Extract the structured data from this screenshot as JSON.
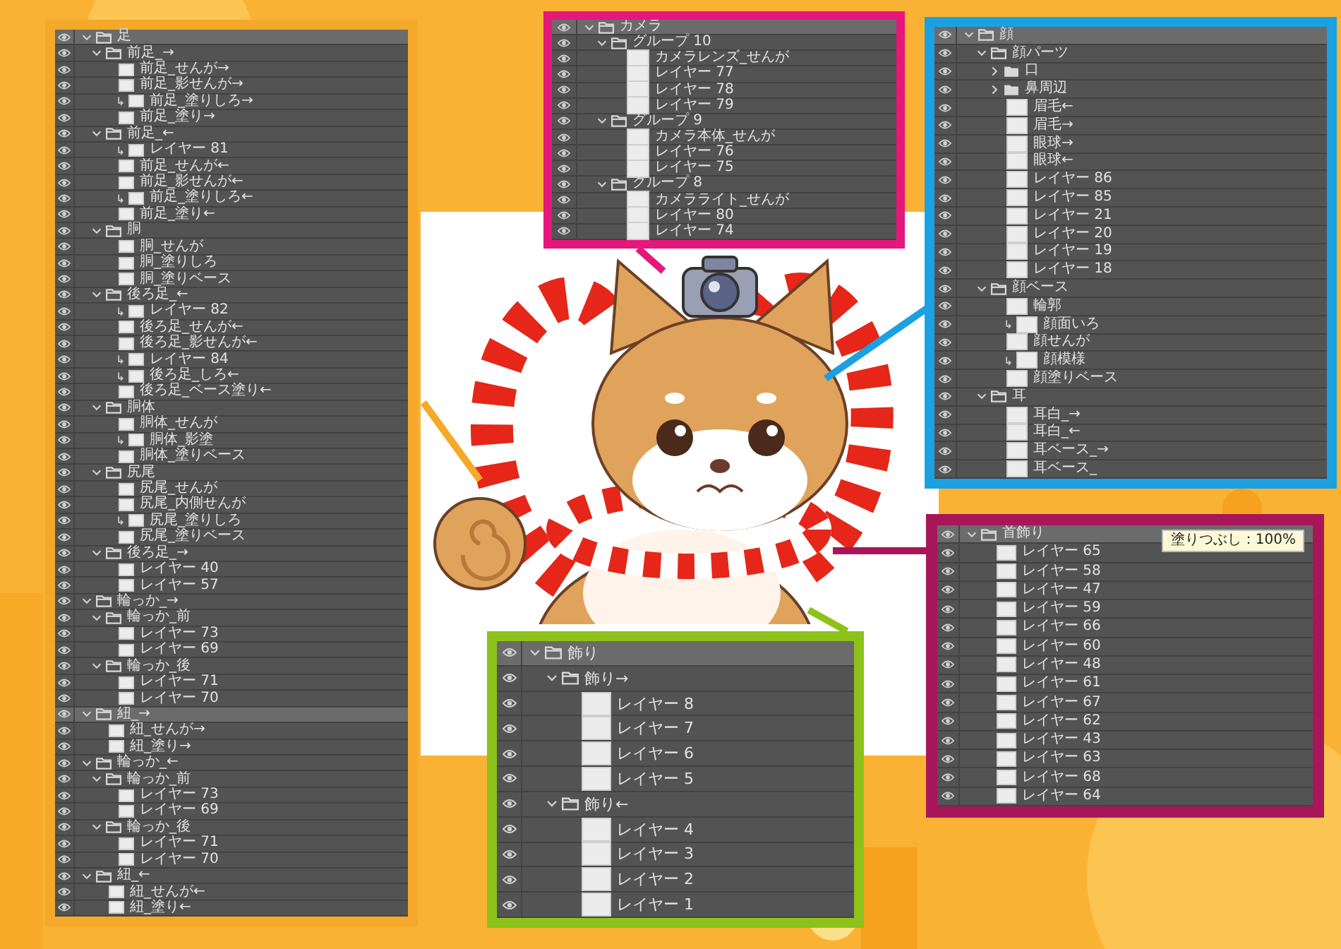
{
  "panels": [
    {
      "color": "#f4a92a",
      "rows": [
        {
          "label": "足",
          "kind": "folder",
          "expanded": true,
          "selected": true,
          "children": [
            {
              "label": "前足_→",
              "kind": "folder",
              "expanded": true,
              "selected": false,
              "children": [
                {
                  "label": "前足_せんが→",
                  "kind": "layer",
                  "selected": false
                },
                {
                  "label": "前足_影せんが→",
                  "kind": "layer",
                  "selected": false
                },
                {
                  "label": "前足_塗りしろ→",
                  "kind": "clipped-layer",
                  "selected": false
                },
                {
                  "label": "前足_塗り→",
                  "kind": "layer",
                  "selected": false
                }
              ]
            },
            {
              "label": "前足_←",
              "kind": "folder",
              "expanded": true,
              "selected": false,
              "children": [
                {
                  "label": "レイヤー 81",
                  "kind": "clipped-layer",
                  "selected": false
                },
                {
                  "label": "前足_せんが←",
                  "kind": "layer",
                  "selected": false
                },
                {
                  "label": "前足_影せんが←",
                  "kind": "layer",
                  "selected": false
                },
                {
                  "label": "前足_塗りしろ←",
                  "kind": "clipped-layer",
                  "selected": false
                },
                {
                  "label": "前足_塗り←",
                  "kind": "layer",
                  "selected": false
                }
              ]
            },
            {
              "label": "胴",
              "kind": "folder",
              "expanded": true,
              "selected": false,
              "children": [
                {
                  "label": "胴_せんが",
                  "kind": "layer",
                  "selected": false
                },
                {
                  "label": "胴_塗りしろ",
                  "kind": "layer",
                  "selected": false
                },
                {
                  "label": "胴_塗りベース",
                  "kind": "layer",
                  "selected": false
                }
              ]
            },
            {
              "label": "後ろ足_←",
              "kind": "folder",
              "expanded": true,
              "selected": false,
              "children": [
                {
                  "label": "レイヤー 82",
                  "kind": "clipped-layer",
                  "selected": false
                },
                {
                  "label": "後ろ足_せんが←",
                  "kind": "layer",
                  "selected": false
                },
                {
                  "label": "後ろ足_影せんが←",
                  "kind": "layer",
                  "selected": false
                },
                {
                  "label": "レイヤー 84",
                  "kind": "clipped-layer",
                  "selected": false
                },
                {
                  "label": "後ろ足_しろ←",
                  "kind": "clipped-layer",
                  "selected": false
                },
                {
                  "label": "後ろ足_ベース塗り←",
                  "kind": "layer",
                  "selected": false
                }
              ]
            },
            {
              "label": "胴体",
              "kind": "folder",
              "expanded": true,
              "selected": false,
              "children": [
                {
                  "label": "胴体_せんが",
                  "kind": "layer",
                  "selected": false
                },
                {
                  "label": "胴体_影塗",
                  "kind": "clipped-layer",
                  "selected": false
                },
                {
                  "label": "胴体_塗りベース",
                  "kind": "layer",
                  "selected": false
                }
              ]
            },
            {
              "label": "尻尾",
              "kind": "folder",
              "expanded": true,
              "selected": false,
              "children": [
                {
                  "label": "尻尾_せんが",
                  "kind": "layer",
                  "selected": false
                },
                {
                  "label": "尻尾_内側せんが",
                  "kind": "layer",
                  "selected": false
                },
                {
                  "label": "尻尾_塗りしろ",
                  "kind": "clipped-layer",
                  "selected": false
                },
                {
                  "label": "尻尾_塗りベース",
                  "kind": "layer",
                  "selected": false
                }
              ]
            },
            {
              "label": "後ろ足_→",
              "kind": "folder",
              "expanded": true,
              "selected": false,
              "children": [
                {
                  "label": "レイヤー 40",
                  "kind": "layer",
                  "selected": false
                },
                {
                  "label": "レイヤー 57",
                  "kind": "layer",
                  "selected": false
                }
              ]
            }
          ]
        },
        {
          "label": "輪っか_→",
          "kind": "folder",
          "expanded": true,
          "selected": false,
          "children": [
            {
              "label": "輪っか_前",
              "kind": "folder",
              "expanded": true,
              "selected": false,
              "children": [
                {
                  "label": "レイヤー 73",
                  "kind": "layer",
                  "selected": false
                },
                {
                  "label": "レイヤー 69",
                  "kind": "layer",
                  "selected": false
                }
              ]
            },
            {
              "label": "輪っか_後",
              "kind": "folder",
              "expanded": true,
              "selected": false,
              "children": [
                {
                  "label": "レイヤー 71",
                  "kind": "layer",
                  "selected": false
                },
                {
                  "label": "レイヤー 70",
                  "kind": "layer",
                  "selected": false
                }
              ]
            }
          ]
        },
        {
          "label": "紐_→",
          "kind": "folder",
          "expanded": true,
          "selected": true,
          "children": [
            {
              "label": "紐_せんが→",
              "kind": "layer",
              "selected": false
            },
            {
              "label": "紐_塗り→",
              "kind": "layer",
              "selected": false
            }
          ]
        },
        {
          "label": "輪っか_←",
          "kind": "folder",
          "expanded": true,
          "selected": false,
          "children": [
            {
              "label": "輪っか_前",
              "kind": "folder",
              "expanded": true,
              "selected": false,
              "children": [
                {
                  "label": "レイヤー 73",
                  "kind": "layer",
                  "selected": false
                },
                {
                  "label": "レイヤー 69",
                  "kind": "layer",
                  "selected": false
                }
              ]
            },
            {
              "label": "輪っか_後",
              "kind": "folder",
              "expanded": true,
              "selected": false,
              "children": [
                {
                  "label": "レイヤー 71",
                  "kind": "layer",
                  "selected": false
                },
                {
                  "label": "レイヤー 70",
                  "kind": "layer",
                  "selected": false
                }
              ]
            }
          ]
        },
        {
          "label": "紐_←",
          "kind": "folder",
          "expanded": true,
          "selected": false,
          "children": [
            {
              "label": "紐_せんが←",
              "kind": "layer",
              "selected": false
            },
            {
              "label": "紐_塗り←",
              "kind": "layer",
              "selected": false
            }
          ]
        }
      ]
    },
    {
      "color": "#e5177b",
      "rows": [
        {
          "label": "カメラ",
          "kind": "folder",
          "expanded": true,
          "selected": true,
          "children": [
            {
              "label": "グループ 10",
              "kind": "folder",
              "expanded": true,
              "selected": false,
              "children": [
                {
                  "label": "カメラレンズ_せんが",
                  "kind": "layer",
                  "selected": false
                },
                {
                  "label": "レイヤー 77",
                  "kind": "layer",
                  "selected": false
                },
                {
                  "label": "レイヤー 78",
                  "kind": "layer",
                  "selected": false
                },
                {
                  "label": "レイヤー 79",
                  "kind": "layer",
                  "selected": false
                }
              ]
            },
            {
              "label": "グループ 9",
              "kind": "folder",
              "expanded": true,
              "selected": false,
              "children": [
                {
                  "label": "カメラ本体_せんが",
                  "kind": "layer",
                  "selected": false
                },
                {
                  "label": "レイヤー 76",
                  "kind": "layer",
                  "selected": false
                },
                {
                  "label": "レイヤー 75",
                  "kind": "layer",
                  "selected": false
                }
              ]
            },
            {
              "label": "グループ 8",
              "kind": "folder",
              "expanded": true,
              "selected": false,
              "children": [
                {
                  "label": "カメラライト_せんが",
                  "kind": "layer",
                  "selected": false
                },
                {
                  "label": "レイヤー 80",
                  "kind": "layer",
                  "selected": false
                },
                {
                  "label": "レイヤー 74",
                  "kind": "layer",
                  "selected": false
                }
              ]
            }
          ]
        }
      ]
    },
    {
      "color": "#1ba1e2",
      "rows": [
        {
          "label": "顔",
          "kind": "folder",
          "expanded": true,
          "selected": true,
          "children": [
            {
              "label": "顔パーツ",
              "kind": "folder",
              "expanded": true,
              "selected": false,
              "children": [
                {
                  "label": "口",
                  "kind": "folder",
                  "expanded": false,
                  "selected": false
                },
                {
                  "label": "鼻周辺",
                  "kind": "folder",
                  "expanded": false,
                  "selected": false
                },
                {
                  "label": "眉毛←",
                  "kind": "layer",
                  "selected": false
                },
                {
                  "label": "眉毛→",
                  "kind": "layer",
                  "selected": false
                },
                {
                  "label": "眼球→",
                  "kind": "layer",
                  "selected": false
                },
                {
                  "label": "眼球←",
                  "kind": "layer",
                  "selected": false
                },
                {
                  "label": "レイヤー 86",
                  "kind": "layer",
                  "selected": false
                },
                {
                  "label": "レイヤー 85",
                  "kind": "layer",
                  "selected": false
                },
                {
                  "label": "レイヤー 21",
                  "kind": "layer",
                  "selected": false
                },
                {
                  "label": "レイヤー 20",
                  "kind": "layer",
                  "selected": false
                },
                {
                  "label": "レイヤー 19",
                  "kind": "layer",
                  "selected": false
                },
                {
                  "label": "レイヤー 18",
                  "kind": "layer",
                  "selected": false
                }
              ]
            },
            {
              "label": "顔ベース",
              "kind": "folder",
              "expanded": true,
              "selected": false,
              "children": [
                {
                  "label": "輪郭",
                  "kind": "layer",
                  "selected": false
                },
                {
                  "label": "顔面いろ",
                  "kind": "clipped-layer",
                  "selected": false
                },
                {
                  "label": "顔せんが",
                  "kind": "layer",
                  "selected": false
                },
                {
                  "label": "顔模様",
                  "kind": "clipped-layer",
                  "selected": false
                },
                {
                  "label": "顔塗りベース",
                  "kind": "layer",
                  "selected": false
                }
              ]
            },
            {
              "label": "耳",
              "kind": "folder",
              "expanded": true,
              "selected": false,
              "children": [
                {
                  "label": "耳白_→",
                  "kind": "layer",
                  "selected": false
                },
                {
                  "label": "耳白_←",
                  "kind": "layer",
                  "selected": false
                },
                {
                  "label": "耳ベース_→",
                  "kind": "layer",
                  "selected": false
                },
                {
                  "label": "耳ベース_",
                  "kind": "layer",
                  "selected": false
                }
              ]
            }
          ]
        }
      ]
    },
    {
      "color": "#a8165a",
      "tooltip": "塗りつぶし：100%",
      "rows": [
        {
          "label": "首飾り",
          "kind": "folder",
          "expanded": true,
          "selected": true,
          "children": [
            {
              "label": "レイヤー 65",
              "kind": "layer",
              "selected": false
            },
            {
              "label": "レイヤー 58",
              "kind": "layer",
              "selected": false
            },
            {
              "label": "レイヤー 47",
              "kind": "layer",
              "selected": false
            },
            {
              "label": "レイヤー 59",
              "kind": "layer",
              "selected": false
            },
            {
              "label": "レイヤー 66",
              "kind": "layer",
              "selected": false
            },
            {
              "label": "レイヤー 60",
              "kind": "layer",
              "selected": false
            },
            {
              "label": "レイヤー 48",
              "kind": "layer",
              "selected": false
            },
            {
              "label": "レイヤー 61",
              "kind": "layer",
              "selected": false
            },
            {
              "label": "レイヤー 67",
              "kind": "layer",
              "selected": false
            },
            {
              "label": "レイヤー 62",
              "kind": "layer",
              "selected": false
            },
            {
              "label": "レイヤー 43",
              "kind": "layer",
              "selected": false
            },
            {
              "label": "レイヤー 63",
              "kind": "layer",
              "selected": false
            },
            {
              "label": "レイヤー 68",
              "kind": "layer",
              "selected": false
            },
            {
              "label": "レイヤー 64",
              "kind": "layer",
              "selected": false
            }
          ]
        }
      ]
    },
    {
      "color": "#8cc21a",
      "rows": [
        {
          "label": "飾り",
          "kind": "folder",
          "expanded": true,
          "selected": true,
          "children": [
            {
              "label": "飾り→",
              "kind": "folder",
              "expanded": true,
              "selected": false,
              "children": [
                {
                  "label": "レイヤー 8",
                  "kind": "layer",
                  "selected": false
                },
                {
                  "label": "レイヤー 7",
                  "kind": "layer",
                  "selected": false
                },
                {
                  "label": "レイヤー 6",
                  "kind": "layer",
                  "selected": false
                },
                {
                  "label": "レイヤー 5",
                  "kind": "layer",
                  "selected": false
                }
              ]
            },
            {
              "label": "飾り←",
              "kind": "folder",
              "expanded": true,
              "selected": false,
              "children": [
                {
                  "label": "レイヤー 4",
                  "kind": "layer",
                  "selected": false
                },
                {
                  "label": "レイヤー 3",
                  "kind": "layer",
                  "selected": false
                },
                {
                  "label": "レイヤー 2",
                  "kind": "layer",
                  "selected": false
                },
                {
                  "label": "レイヤー 1",
                  "kind": "layer",
                  "selected": false
                }
              ]
            }
          ]
        }
      ]
    }
  ]
}
